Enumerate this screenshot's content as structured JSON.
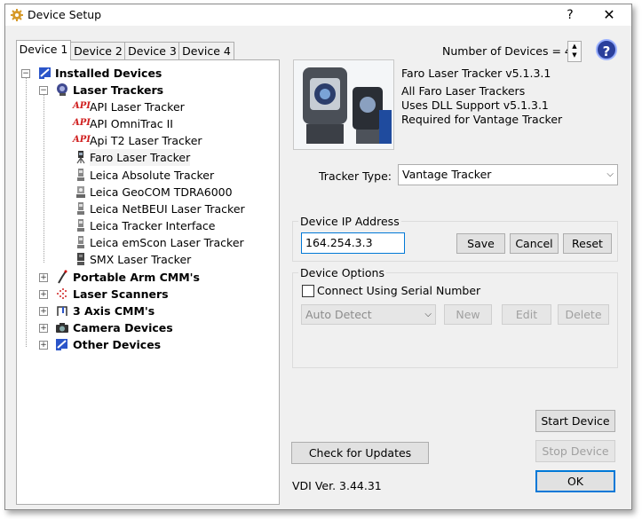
{
  "window": {
    "title": "Device Setup",
    "help_label": "?",
    "close_label": "✕"
  },
  "tabs": [
    "Device 1",
    "Device 2",
    "Device 3",
    "Device 4"
  ],
  "number_of_devices": {
    "label": "Number of Devices = 4"
  },
  "help_button": {
    "label": "?"
  },
  "tree": {
    "root": "Installed Devices",
    "laser_trackers": "Laser Trackers",
    "tracker_items": [
      "API Laser Tracker",
      "API OmniTrac II",
      "Api T2 Laser Tracker",
      "Faro Laser Tracker",
      "Leica Absolute Tracker",
      "Leica GeoCOM TDRA6000",
      "Leica NetBEUI Laser Tracker",
      "Leica Tracker Interface",
      "Leica emScon Laser Tracker",
      "SMX Laser Tracker"
    ],
    "api_icon_text": "API",
    "categories": [
      "Portable Arm CMM's",
      "Laser Scanners",
      "3 Axis CMM's",
      "Camera Devices",
      "Other Devices"
    ]
  },
  "device_info": {
    "lines": [
      "Faro Laser Tracker v5.1.3.1",
      "All Faro Laser Trackers",
      "Uses DLL Support v5.1.3.1",
      "Required for Vantage Tracker"
    ]
  },
  "tracker_type": {
    "label": "Tracker Type:",
    "value": "Vantage Tracker"
  },
  "ip_group": {
    "title": "Device IP Address",
    "value": "164.254.3.3",
    "save": "Save",
    "cancel": "Cancel",
    "reset": "Reset"
  },
  "options_group": {
    "title": "Device Options",
    "checkbox_label": "Connect Using Serial Number",
    "detect_value": "Auto Detect",
    "new": "New",
    "edit": "Edit",
    "delete": "Delete"
  },
  "buttons": {
    "check_updates": "Check for Updates",
    "start": "Start Device",
    "stop": "Stop Device",
    "ok": "OK"
  },
  "version": "VDI Ver. 3.44.31",
  "colors": {
    "accent": "#0078d7",
    "api_red": "#d02020",
    "help_blue": "#2a3f9c",
    "window_bg": "#f0f0f0"
  }
}
